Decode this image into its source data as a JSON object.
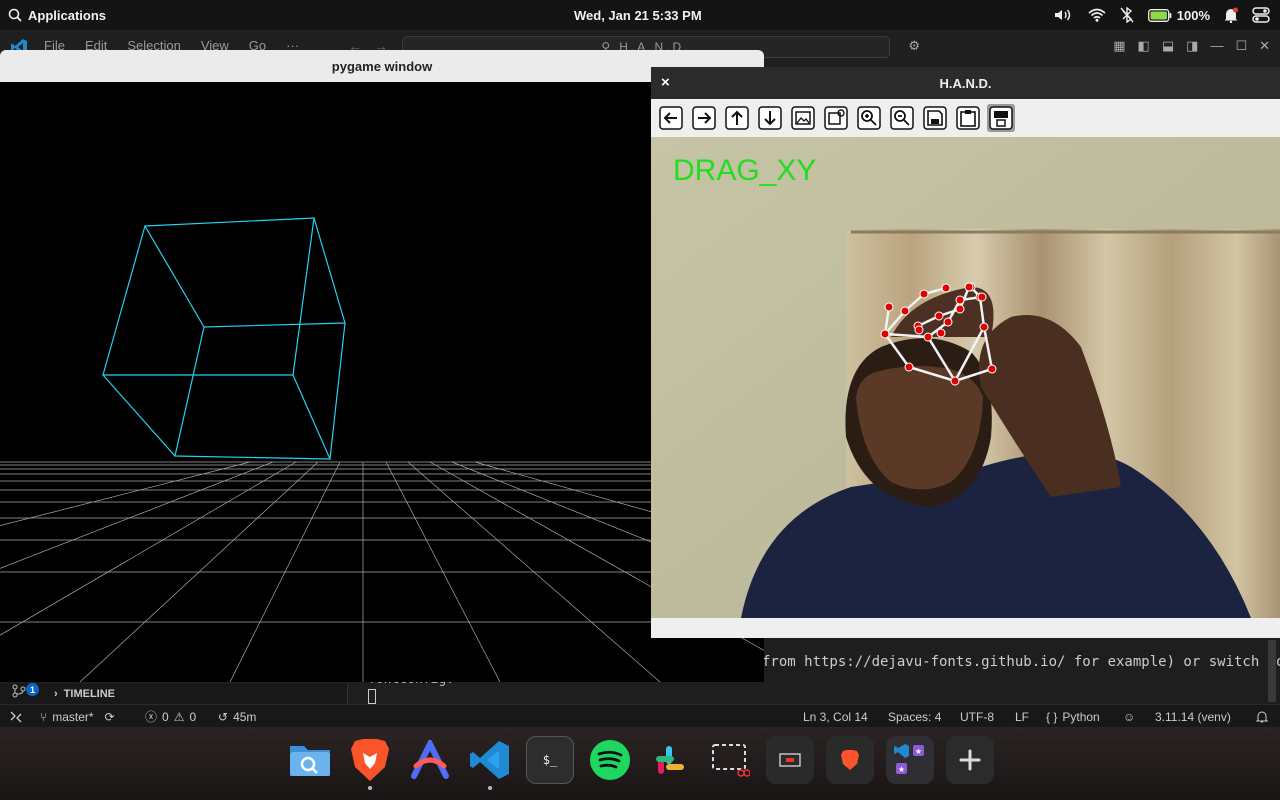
{
  "topbar": {
    "apps_label": "Applications",
    "datetime": "Wed, Jan 21  5:33 PM",
    "battery": "100%"
  },
  "vscode": {
    "menu": [
      "File",
      "Edit",
      "Selection",
      "View",
      "Go",
      "···"
    ],
    "search_text": "H.A.N.D.",
    "terminal_line": "from https://dejavu-fonts.github.io/ for example) or switch to",
    "terminal_partial": "fontconfig.",
    "panel": {
      "badge_count": "1",
      "timeline_label": "TIMELINE"
    },
    "status": {
      "branch": "master*",
      "errors": "0",
      "warnings": "0",
      "time": "45m",
      "cursor": "Ln 3, Col 14",
      "spaces": "Spaces: 4",
      "encoding": "UTF-8",
      "eol": "LF",
      "language": "Python",
      "language_braces": "{ }",
      "interpreter": "3.11.14 (venv)"
    }
  },
  "pygame": {
    "title": "pygame window",
    "wire_color": "#22d3ee"
  },
  "hand": {
    "title": "H.A.N.D.",
    "close_label": "×",
    "overlay_text": "DRAG_XY",
    "overlay_color": "#22dd22",
    "landmark_color": "#e00000",
    "toolbar": [
      "back-arrow-icon",
      "forward-arrow-icon",
      "up-arrow-icon",
      "down-arrow-icon",
      "image-icon",
      "image-settings-icon",
      "zoom-in-icon",
      "zoom-out-icon",
      "save-icon",
      "clipboard-icon",
      "save-properties-icon"
    ]
  },
  "dock": [
    "finder-icon",
    "brave-icon",
    "arc-icon",
    "vscode-icon",
    "terminal-icon",
    "spotify-icon",
    "slack-icon",
    "screenshot-icon",
    "pixel-app-icon",
    "brave-small-icon",
    "vscode-group-icon",
    "add-icon"
  ]
}
